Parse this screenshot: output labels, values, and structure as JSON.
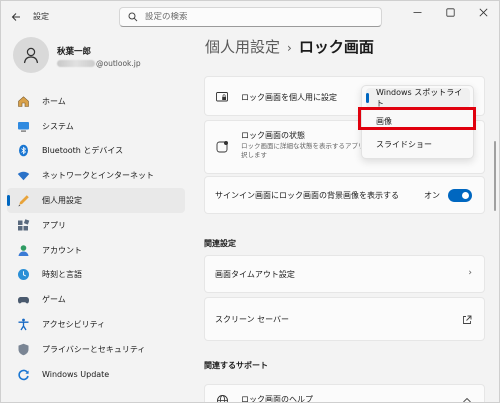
{
  "titlebar": {
    "app_title": "設定",
    "search_placeholder": "設定の検索"
  },
  "user": {
    "name": "秋葉一郎",
    "email_visible": "@outlook.jp"
  },
  "nav": {
    "items": [
      {
        "label": "ホーム",
        "icon": "home-icon"
      },
      {
        "label": "システム",
        "icon": "system-icon"
      },
      {
        "label": "Bluetooth とデバイス",
        "icon": "bluetooth-icon"
      },
      {
        "label": "ネットワークとインターネット",
        "icon": "wifi-icon"
      },
      {
        "label": "個人用設定",
        "icon": "personalization-icon",
        "active": true
      },
      {
        "label": "アプリ",
        "icon": "apps-icon"
      },
      {
        "label": "アカウント",
        "icon": "account-icon"
      },
      {
        "label": "時刻と言語",
        "icon": "time-language-icon"
      },
      {
        "label": "ゲーム",
        "icon": "game-icon"
      },
      {
        "label": "アクセシビリティ",
        "icon": "accessibility-icon"
      },
      {
        "label": "プライバシーとセキュリティ",
        "icon": "shield-icon"
      },
      {
        "label": "Windows Update",
        "icon": "windows-update-icon"
      }
    ]
  },
  "main": {
    "breadcrumb_parent": "個人用設定",
    "breadcrumb_separator": "›",
    "title": "ロック画面",
    "lock_personalize": {
      "label": "ロック画面を個人用に設定"
    },
    "lock_status": {
      "label": "ロック画面の状態",
      "desc": "ロック画面に詳細な状態を表示するアプリ",
      "desc2": "択します"
    },
    "signin_background": {
      "label": "サインイン画面にロック画面の背景画像を表示する",
      "toggle_label": "オン",
      "toggle_on": true
    },
    "related_settings": {
      "title": "関連設定",
      "screen_timeout": "画面タイムアウト設定",
      "screensaver": "スクリーン セーバー"
    },
    "related_support": {
      "title": "関連するサポート",
      "lock_help": "ロック画面のヘルプ"
    }
  },
  "dropdown": {
    "options": [
      "Windows スポットライト",
      "画像",
      "スライドショー"
    ],
    "selected_index": 0,
    "highlighted_index": 1,
    "highlight_color": "#e0000d"
  },
  "colors": {
    "accent": "#0067c0",
    "background": "#f3f3f3",
    "card": "#fbfbfb"
  }
}
